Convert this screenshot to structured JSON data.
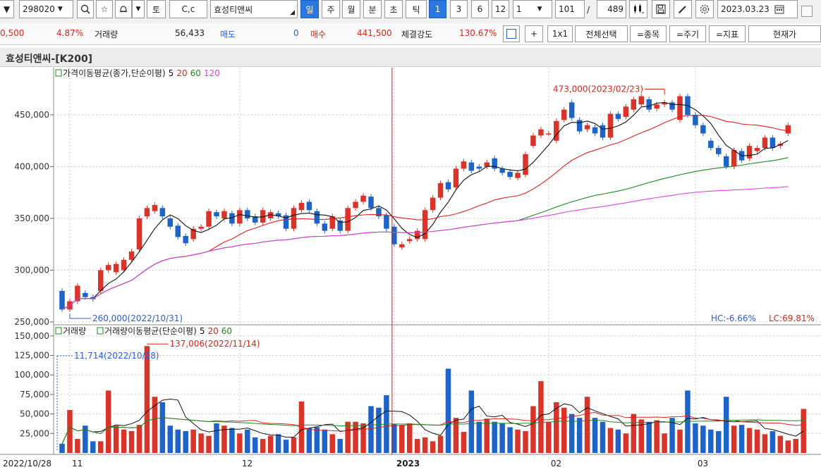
{
  "toolbar": {
    "code": "298020",
    "stock_name": "효성티앤씨",
    "btn_to": "토",
    "btn_cc": "C,c",
    "periods": [
      "일",
      "주",
      "월",
      "분",
      "초",
      "틱"
    ],
    "nums": [
      "1",
      "3",
      "6",
      "12"
    ],
    "unit": "1",
    "count": "101",
    "slash": "/",
    "total": "489",
    "date": "2023.03.23"
  },
  "quote": {
    "price": "0,500",
    "change_pct": "4.87%",
    "volume_label": "거래량",
    "volume": "56,433",
    "sell_label": "매도",
    "sell": "0",
    "buy_label": "매수",
    "buy": "441,500",
    "strength_label": "체결강도",
    "strength": "130.67%",
    "btn_plus": "+",
    "btn_1x1": "1x1",
    "btn_select_all": "전체선택",
    "btn_item": "=종목",
    "btn_period": "=주기",
    "btn_indicator": "=지표",
    "btn_current": "현재가"
  },
  "chart_title": "효성티앤씨-[K200]",
  "chart_data": {
    "type": "candlestick",
    "price_legend": {
      "name": "가격이동평균(종가,단순이평)",
      "p5": "5",
      "p20": "20",
      "p60": "60",
      "p120": "120"
    },
    "volume_legend": {
      "name1": "거래량",
      "name2": "거래량이동평균(단순이평)",
      "p5": "5",
      "p20": "20",
      "p60": "60"
    },
    "y_ticks": [
      "450,000",
      "400,000",
      "350,000",
      "300,000",
      "250,000"
    ],
    "y_tick_values": [
      450000,
      400000,
      350000,
      300000,
      250000
    ],
    "vol_ticks": [
      "150,000",
      "125,000",
      "100,000",
      "75,000",
      "50,000",
      "25,000"
    ],
    "vol_tick_values": [
      150000,
      125000,
      100000,
      75000,
      50000,
      25000
    ],
    "x_labels": [
      {
        "i": 0,
        "text": "2022/10/28"
      },
      {
        "i": 1,
        "text": "11"
      },
      {
        "i": 23,
        "text": "12"
      },
      {
        "i": 43,
        "text": "2023"
      },
      {
        "i": 63,
        "text": "02"
      },
      {
        "i": 82,
        "text": "03"
      }
    ],
    "annotations": {
      "max_price": "473,000(2023/02/23)",
      "min_price": "260,000(2022/10/31)",
      "max_vol": "137,006(2022/11/14)",
      "min_vol": "11,714(2022/10/28)",
      "hc": "HC:-6.66%",
      "lc": "LC:69.81%"
    },
    "colors": {
      "up": "#d8342a",
      "down": "#1e64c8",
      "ma5": "#111111",
      "ma20": "#e02020",
      "ma60": "#1a8c1a",
      "ma120": "#e040e0"
    },
    "candles": [
      [
        280000,
        262000
      ],
      [
        262000,
        270000
      ],
      [
        270000,
        285000
      ],
      [
        278000,
        274000
      ],
      [
        274000,
        272000
      ],
      [
        280000,
        300000
      ],
      [
        300000,
        305000
      ],
      [
        298000,
        306000
      ],
      [
        300000,
        310000
      ],
      [
        310000,
        318000
      ],
      [
        320000,
        350000
      ],
      [
        352000,
        360000
      ],
      [
        357000,
        363000
      ],
      [
        360000,
        352000
      ],
      [
        350000,
        342000
      ],
      [
        343000,
        332000
      ],
      [
        333000,
        326000
      ],
      [
        330000,
        340000
      ],
      [
        340000,
        342000
      ],
      [
        342000,
        357000
      ],
      [
        356000,
        352000
      ],
      [
        350000,
        357000
      ],
      [
        355000,
        345000
      ],
      [
        345000,
        358000
      ],
      [
        358000,
        350000
      ],
      [
        352000,
        346000
      ],
      [
        346000,
        358000
      ],
      [
        350000,
        356000
      ],
      [
        355000,
        352000
      ],
      [
        353000,
        340000
      ],
      [
        340000,
        360000
      ],
      [
        358000,
        365000
      ],
      [
        366000,
        358000
      ],
      [
        357000,
        345000
      ],
      [
        345000,
        338000
      ],
      [
        340000,
        352000
      ],
      [
        348000,
        338000
      ],
      [
        338000,
        360000
      ],
      [
        360000,
        366000
      ],
      [
        366000,
        372000
      ],
      [
        371000,
        360000
      ],
      [
        360000,
        352000
      ],
      [
        353000,
        340000
      ],
      [
        342000,
        325000
      ],
      [
        322000,
        325000
      ],
      [
        328000,
        330000
      ],
      [
        330000,
        338000
      ],
      [
        330000,
        358000
      ],
      [
        358000,
        370000
      ],
      [
        370000,
        384000
      ],
      [
        385000,
        378000
      ],
      [
        380000,
        398000
      ],
      [
        398000,
        405000
      ],
      [
        404000,
        396000
      ],
      [
        400000,
        398000
      ],
      [
        400000,
        404000
      ],
      [
        408000,
        398000
      ],
      [
        398000,
        394000
      ],
      [
        395000,
        390000
      ],
      [
        389000,
        394000
      ],
      [
        392000,
        412000
      ],
      [
        420000,
        430000
      ],
      [
        430000,
        436000
      ],
      [
        432000,
        432000
      ],
      [
        425000,
        444000
      ],
      [
        445000,
        455000
      ],
      [
        462000,
        447000
      ],
      [
        445000,
        434000
      ],
      [
        436000,
        440000
      ],
      [
        438000,
        432000
      ],
      [
        440000,
        428000
      ],
      [
        428000,
        451000
      ],
      [
        451000,
        446000
      ],
      [
        448000,
        458000
      ],
      [
        455000,
        465000
      ],
      [
        460000,
        468000
      ],
      [
        465000,
        455000
      ],
      [
        456000,
        460000
      ],
      [
        460000,
        462000
      ],
      [
        462000,
        455000
      ],
      [
        445000,
        468000
      ],
      [
        468000,
        450000
      ],
      [
        450000,
        440000
      ],
      [
        440000,
        432000
      ],
      [
        425000,
        418000
      ],
      [
        418000,
        412000
      ],
      [
        410000,
        400000
      ],
      [
        400000,
        416000
      ],
      [
        415000,
        406000
      ],
      [
        408000,
        420000
      ],
      [
        415000,
        418000
      ],
      [
        418000,
        428000
      ],
      [
        428000,
        418000
      ],
      [
        420000,
        422000
      ],
      [
        432000,
        440000
      ]
    ],
    "volumes": [
      11714,
      55000,
      18000,
      35000,
      15000,
      15000,
      80000,
      35000,
      30000,
      28000,
      36000,
      137006,
      72000,
      65000,
      35000,
      30000,
      28000,
      30000,
      25000,
      22000,
      38000,
      35000,
      32000,
      25000,
      30000,
      20000,
      18000,
      22000,
      24000,
      17000,
      20000,
      66000,
      32000,
      33000,
      30000,
      24000,
      18000,
      40000,
      40000,
      38000,
      60000,
      58000,
      74000,
      37000,
      36000,
      38000,
      18000,
      20000,
      15000,
      22000,
      108000,
      45000,
      27000,
      80000,
      40000,
      44000,
      40000,
      38000,
      33000,
      30000,
      28000,
      60000,
      92000,
      40000,
      65000,
      58000,
      50000,
      45000,
      72000,
      45000,
      40000,
      32000,
      30000,
      25000,
      50000,
      43000,
      40000,
      42000,
      25000,
      45000,
      30000,
      80000,
      38000,
      35000,
      30000,
      28000,
      72000,
      35000,
      36000,
      32000,
      30000,
      24000,
      28000,
      22000,
      16000,
      18000,
      56433
    ]
  }
}
